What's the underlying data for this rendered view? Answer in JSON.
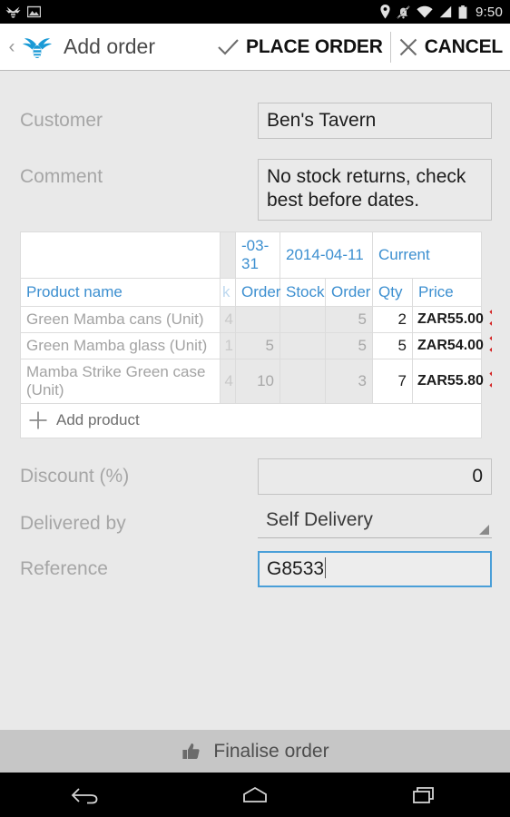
{
  "status_bar": {
    "time": "9:50",
    "left_icons": [
      "app-notification-bee-icon",
      "screenshot-image-icon"
    ],
    "right_icons": [
      "location-pin-icon",
      "ringer-silent-icon",
      "wifi-icon",
      "cellular-signal-icon",
      "battery-icon"
    ]
  },
  "app_bar": {
    "back_chevron": "‹",
    "logo": "bee-logo",
    "title": "Add order",
    "actions": [
      {
        "icon": "check-icon",
        "label": "PLACE ORDER"
      },
      {
        "icon": "close-icon",
        "label": "CANCEL"
      }
    ]
  },
  "form": {
    "customer": {
      "label": "Customer",
      "value": "Ben's Tavern"
    },
    "comment": {
      "label": "Comment",
      "value": "No stock returns, check best before dates."
    },
    "discount": {
      "label": "Discount (%)",
      "value": "0"
    },
    "delivered_by": {
      "label": "Delivered by",
      "value": "Self Delivery"
    },
    "reference": {
      "label": "Reference",
      "value": "G8533",
      "focused": true
    }
  },
  "product_table": {
    "date_headers": [
      "",
      "-03-31",
      "2014-04-11",
      "Current"
    ],
    "clipped_date_header": "",
    "column_headers": {
      "name": "Product name",
      "clipped": "k",
      "order_prev": "Order",
      "stock": "Stock",
      "order": "Order",
      "qty": "Qty",
      "price": "Price"
    },
    "rows": [
      {
        "name": "Green Mamba cans (Unit)",
        "clipped": "4",
        "order_prev": "",
        "stock": "",
        "order": "5",
        "qty": "2",
        "price": "ZAR55.00",
        "delete_icon": "delete-x-icon"
      },
      {
        "name": "Green Mamba glass (Unit)",
        "clipped": "1",
        "order_prev": "5",
        "stock": "",
        "order": "5",
        "qty": "5",
        "price": "ZAR54.00",
        "delete_icon": "delete-x-icon"
      },
      {
        "name": "Mamba Strike Green case (Unit)",
        "clipped": "4",
        "order_prev": "10",
        "stock": "",
        "order": "3",
        "qty": "7",
        "price": "ZAR55.80",
        "delete_icon": "delete-x-icon"
      }
    ],
    "add_row": {
      "icon": "plus-icon",
      "label": "Add product"
    }
  },
  "bottom_bar": {
    "icon": "thumbs-up-icon",
    "label": "Finalise order"
  },
  "nav_bar": {
    "buttons": [
      "back-nav-icon",
      "home-nav-icon",
      "recents-nav-icon"
    ]
  },
  "colors": {
    "accent_blue": "#3c8fd0",
    "delete_red": "#d32020",
    "focus_blue": "#4a9fd8",
    "bar_grey": "#c6c6c6"
  }
}
